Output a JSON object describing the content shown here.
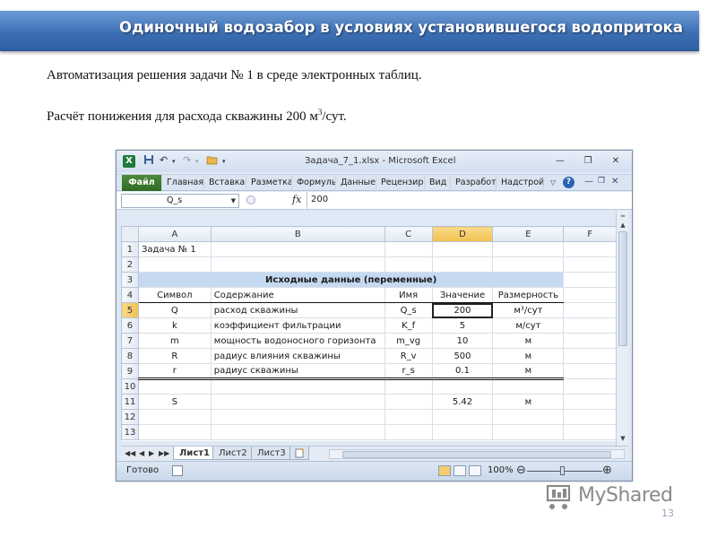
{
  "slide": {
    "title": "Одиночный водозабор в условиях установившегося водопритока",
    "line1": "Автоматизация  решения  задачи № 1 в среде электронных таблиц.",
    "line2_main": "Расчёт понижения для расхода скважины 200 м",
    "line2_sup": "3",
    "line2_tail": "/сут.",
    "page_number": "13",
    "watermark": "MyShared"
  },
  "excel": {
    "logo": "X",
    "window_title": "Задача_7_1.xlsx  -  Microsoft Excel",
    "ribbon_tabs": [
      "Файл",
      "Главная",
      "Вставка",
      "Разметка",
      "Формулы",
      "Данные",
      "Рецензир",
      "Вид",
      "Разработ",
      "Надстрой"
    ],
    "name_box": "Q_s",
    "fx": "fx",
    "formula_value": "200",
    "columns": [
      "A",
      "B",
      "C",
      "D",
      "E",
      "F"
    ],
    "active_column": "D",
    "active_row": "5",
    "rows": [
      {
        "num": "1",
        "A": "Задача № 1",
        "B": "",
        "C": "",
        "D": "",
        "E": ""
      },
      {
        "num": "2",
        "A": "",
        "B": "",
        "C": "",
        "D": "",
        "E": ""
      },
      {
        "num": "3",
        "A": "",
        "B": "Исходные данные (переменные)",
        "C": "",
        "D": "",
        "E": ""
      },
      {
        "num": "4",
        "A": "Символ",
        "B": "Содержание",
        "C": "Имя",
        "D": "Значение",
        "E": "Размерность"
      },
      {
        "num": "5",
        "A": "Q",
        "B": "расход скважины",
        "C": "Q_s",
        "D": "200",
        "E": "м³/сут"
      },
      {
        "num": "6",
        "A": "k",
        "B": "коэффициент фильтрации",
        "C": "K_f",
        "D": "5",
        "E": "м/сут"
      },
      {
        "num": "7",
        "A": "m",
        "B": "мощность водоносного горизонта",
        "C": "m_vg",
        "D": "10",
        "E": "м"
      },
      {
        "num": "8",
        "A": "R",
        "B": "радиус влияния скважины",
        "C": "R_v",
        "D": "500",
        "E": "м"
      },
      {
        "num": "9",
        "A": "r",
        "B": "радиус скважины",
        "C": "r_s",
        "D": "0.1",
        "E": "м"
      },
      {
        "num": "10",
        "A": "",
        "B": "",
        "C": "",
        "D": "",
        "E": ""
      },
      {
        "num": "11",
        "A": "S",
        "B": "",
        "C": "",
        "D": "5.42",
        "E": "м"
      },
      {
        "num": "12",
        "A": "",
        "B": "",
        "C": "",
        "D": "",
        "E": ""
      },
      {
        "num": "13",
        "A": "",
        "B": "",
        "C": "",
        "D": "",
        "E": ""
      }
    ],
    "sheet_tabs": [
      "Лист1",
      "Лист2",
      "Лист3"
    ],
    "active_sheet": "Лист1",
    "status": "Готово",
    "zoom": "100%"
  }
}
